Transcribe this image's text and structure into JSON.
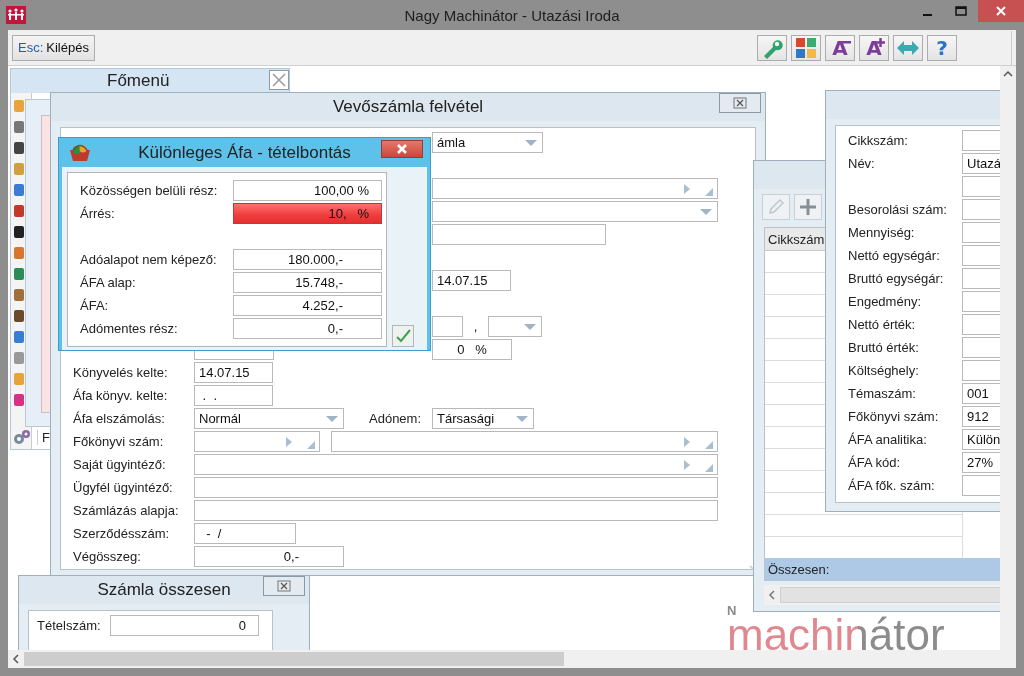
{
  "window": {
    "title": "Nagy Machinátor - Utazási Iroda"
  },
  "toolbar": {
    "exit_button": {
      "key": "Esc:",
      "label": "Kilépés"
    },
    "tool_buttons": [
      {
        "kind": "wrench"
      },
      {
        "kind": "tiles"
      },
      {
        "kind": "font-smaller",
        "glyph": "A"
      },
      {
        "kind": "font-larger",
        "glyph": "A"
      },
      {
        "kind": "arrows"
      },
      {
        "kind": "help",
        "glyph": "?"
      }
    ]
  },
  "main_menu": {
    "title": "Főmenü",
    "footer_text": "F"
  },
  "invoice": {
    "title": "Vevőszámla felvétel",
    "rows": [
      {
        "right": {
          "fields": [
            {
              "kind": "combo",
              "value": "ámla"
            }
          ]
        }
      },
      {
        "gap_above": true,
        "right": {
          "fields": [
            {
              "kind": "lookup-wide"
            }
          ]
        }
      },
      {
        "right": {
          "fields": [
            {
              "kind": "combo-wide"
            }
          ]
        }
      },
      {
        "right": {
          "fields": [
            {
              "kind": "text-m"
            }
          ]
        }
      },
      {
        "gap_above": true,
        "right": {
          "fields": [
            {
              "kind": "date",
              "value": "14.07.15"
            }
          ]
        }
      },
      {
        "gap_above": true,
        "right": {
          "fields": [
            {
              "kind": "text-xs"
            },
            {
              "kind": "sep",
              "value": ","
            },
            {
              "kind": "combo-xs"
            }
          ]
        }
      },
      {
        "left": {
          "fields": [
            {
              "kind": "pct"
            }
          ]
        },
        "right": {
          "fields": [
            {
              "kind": "pct",
              "value": "0   %"
            }
          ]
        }
      },
      {
        "left": {
          "label": "Könyvelés kelte:",
          "fields": [
            {
              "kind": "date",
              "value": "14.07.15"
            }
          ]
        }
      },
      {
        "left": {
          "label": "Áfa könyv. kelte:",
          "fields": [
            {
              "kind": "date",
              "value": " .  ."
            }
          ]
        }
      },
      {
        "left": {
          "label": "Áfa elszámolás:",
          "fields": [
            {
              "kind": "combo-m",
              "value": "Normál"
            }
          ]
        },
        "right": {
          "label": "Adónem:",
          "fields": [
            {
              "kind": "combo-s",
              "value": "Társasági"
            }
          ]
        }
      },
      {
        "left": {
          "label": "Főkönyvi szám:",
          "fields": [
            {
              "kind": "lookup-s"
            },
            {
              "kind": "lookup-wide"
            }
          ]
        }
      },
      {
        "left": {
          "label": "Saját ügyintéző:",
          "fields": [
            {
              "kind": "lookup-wide"
            }
          ]
        }
      },
      {
        "left": {
          "label": "Ügyfél ügyintéző:",
          "fields": [
            {
              "kind": "text-wide"
            }
          ]
        }
      },
      {
        "left": {
          "label": "Számlázás alapja:",
          "fields": [
            {
              "kind": "text-wide"
            }
          ]
        }
      },
      {
        "left": {
          "label": "Szerződésszám:",
          "fields": [
            {
              "kind": "short",
              "value": "  -  /"
            }
          ]
        }
      },
      {
        "left": {
          "label": "Végösszeg:",
          "fields": [
            {
              "kind": "total",
              "value": "0,-"
            }
          ]
        }
      }
    ]
  },
  "vat_dialog": {
    "title": "Különleges Áfa - tételbontás",
    "sections": [
      {
        "rows": [
          {
            "label": "Közösségen belüli rész:",
            "value": "100,00 %",
            "kind": "pct",
            "invalid": false
          },
          {
            "label": "Árrés:",
            "value": "10,   %",
            "kind": "pct",
            "invalid": true
          }
        ]
      },
      {
        "rows": [
          {
            "label": "Adóalapot nem képező:",
            "value": "180.000,-",
            "kind": "amount",
            "invalid": false
          },
          {
            "label": "ÁFA alap:",
            "value": "15.748,-",
            "kind": "amount",
            "invalid": false
          },
          {
            "label": "ÁFA:",
            "value": "4.252,-",
            "kind": "amount",
            "invalid": false
          },
          {
            "label": "Adómentes rész:",
            "value": "0,-",
            "kind": "amount",
            "invalid": false
          }
        ]
      }
    ]
  },
  "totals": {
    "title": "Számla összesen",
    "rows": [
      {
        "label": "Tételszám:",
        "value": "0"
      }
    ]
  },
  "items_window": {
    "tools": [
      {
        "kind": "pencil",
        "disabled": true
      },
      {
        "kind": "plus",
        "disabled": false
      }
    ],
    "table": {
      "columns": [
        "Cikkszám"
      ]
    },
    "footer": "Összesen:"
  },
  "item_form": {
    "rows": [
      {
        "label": "Cikkszám:"
      },
      {
        "label": "Név:",
        "value": "Utazá"
      },
      {},
      {
        "label": "Besorolási szám:"
      },
      {
        "label": "Mennyiség:"
      },
      {
        "label": "Nettó egységár:"
      },
      {
        "label": "Bruttó egységár:"
      },
      {
        "label": "Engedmény:"
      },
      {
        "label": "Nettó érték:"
      },
      {
        "label": "Bruttó érték:"
      },
      {
        "label": "Költséghely:"
      },
      {
        "label": "Témaszám:",
        "value": "001"
      },
      {
        "label": "Főkönyvi szám:",
        "value": "912"
      },
      {
        "label": "ÁFA analitika:",
        "value": "Külön"
      },
      {
        "label": "ÁFA kód:",
        "value": "27%"
      },
      {
        "label": "ÁFA fők. szám:"
      }
    ]
  },
  "logo": {
    "small": "N",
    "text": "machinátor"
  }
}
